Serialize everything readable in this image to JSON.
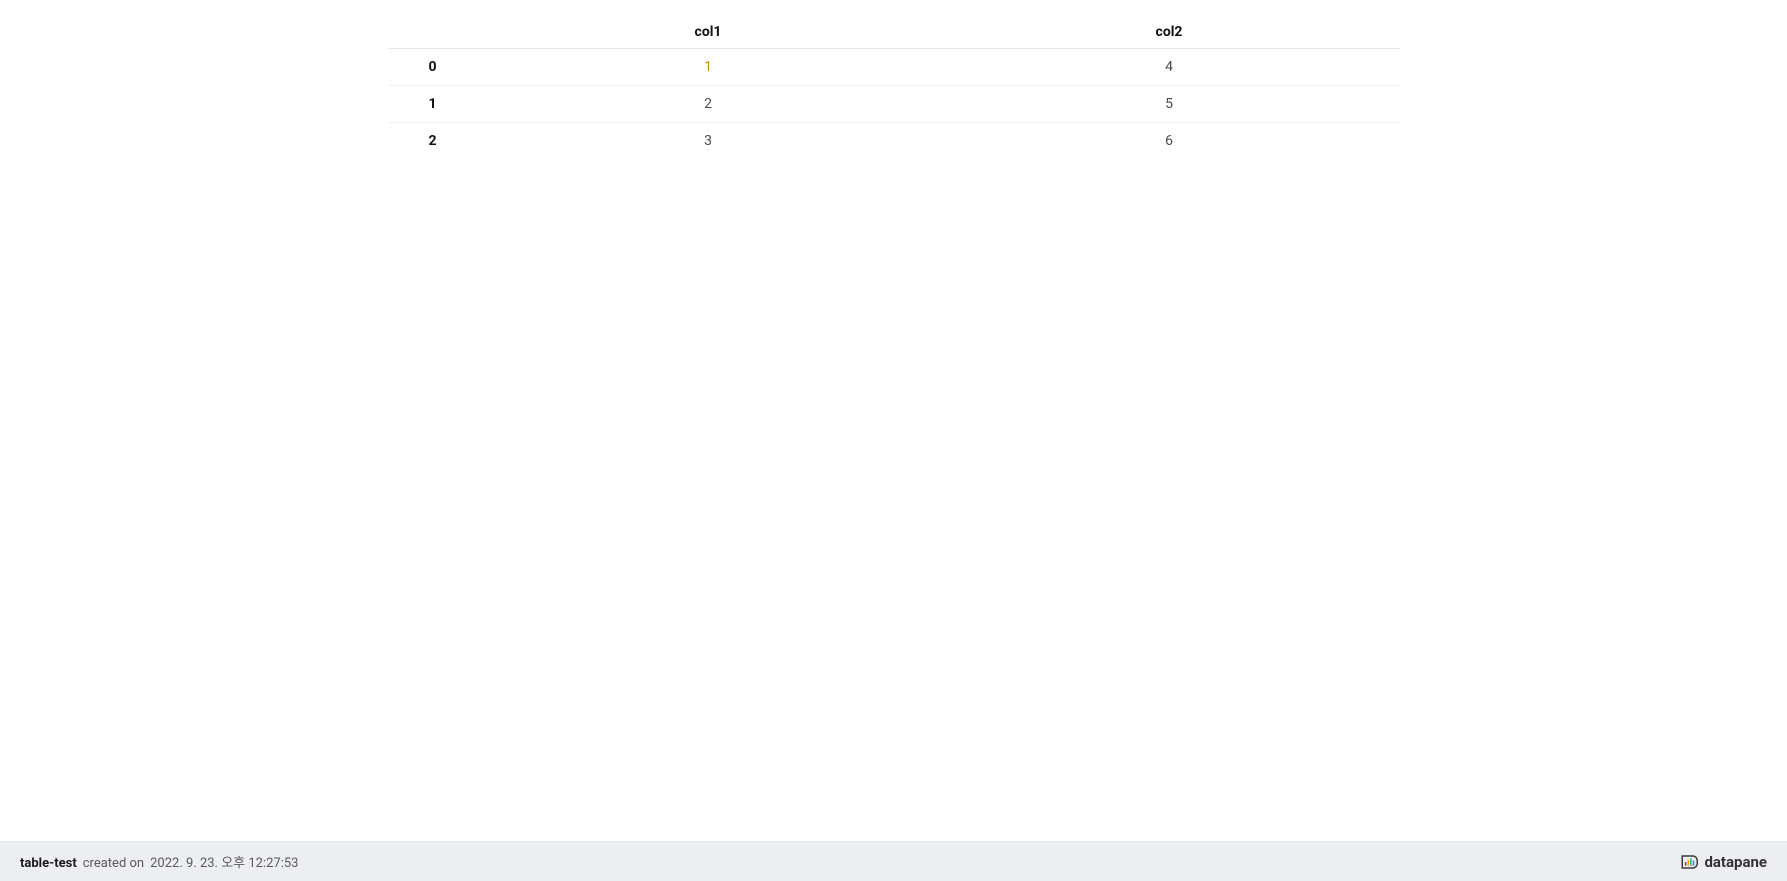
{
  "chart_data": {
    "type": "table",
    "columns": [
      "col1",
      "col2"
    ],
    "index": [
      "0",
      "1",
      "2"
    ],
    "rows": [
      {
        "col1": "1",
        "col2": "4"
      },
      {
        "col1": "2",
        "col2": "5"
      },
      {
        "col1": "3",
        "col2": "6"
      }
    ]
  },
  "table": {
    "headers": {
      "index": "",
      "col1": "col1",
      "col2": "col2"
    },
    "rows": [
      {
        "index": "0",
        "col1": "1",
        "col2": "4",
        "col1_highlight": true
      },
      {
        "index": "1",
        "col1": "2",
        "col2": "5",
        "col1_highlight": false
      },
      {
        "index": "2",
        "col1": "3",
        "col2": "6",
        "col1_highlight": false
      }
    ]
  },
  "footer": {
    "title": "table-test",
    "created_label": "created on",
    "created_on": "2022. 9. 23. 오후 12:27:53",
    "brand": "datapane"
  }
}
